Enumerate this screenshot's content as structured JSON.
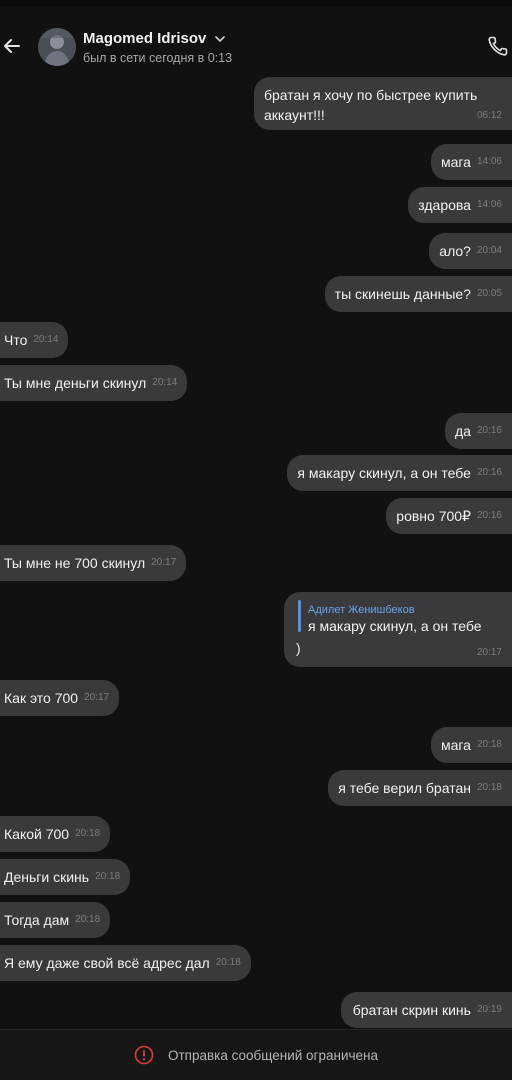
{
  "header": {
    "contact_name": "Magomed Idrisov",
    "last_seen": "был в сети сегодня в 0:13"
  },
  "icons": {
    "back": "arrow-left-icon",
    "chevron": "chevron-down-icon",
    "call": "phone-icon",
    "alert": "alert-circle-icon"
  },
  "messages": [
    {
      "dir": "out",
      "text_line1": "братан я хочу по быстрее купить",
      "text_line2": "аккаунт!!!",
      "time": "06:12"
    },
    {
      "dir": "out",
      "text": "мага",
      "time": "14:06"
    },
    {
      "dir": "out",
      "text": "здарова",
      "time": "14:06"
    },
    {
      "dir": "out",
      "text": "ало?",
      "time": "20:04"
    },
    {
      "dir": "out",
      "text": "ты скинешь данные?",
      "time": "20:05"
    },
    {
      "dir": "in",
      "text": "Что",
      "time": "20:14"
    },
    {
      "dir": "in",
      "text": "Ты мне деньги скинул",
      "time": "20:14"
    },
    {
      "dir": "out",
      "text": "да",
      "time": "20:16"
    },
    {
      "dir": "out",
      "text": "я макару скинул, а он тебе",
      "time": "20:16"
    },
    {
      "dir": "out",
      "text": "ровно 700₽",
      "time": "20:16"
    },
    {
      "dir": "in",
      "text": "Ты мне не 700 скинул",
      "time": "20:17"
    },
    {
      "dir": "out",
      "reply_author": "Адилет Женишбеков",
      "reply_text": "я макару скинул, а он тебе",
      "text": ")",
      "time": "20:17"
    },
    {
      "dir": "in",
      "text": "Как это 700",
      "time": "20:17"
    },
    {
      "dir": "out",
      "text": "мага",
      "time": "20:18"
    },
    {
      "dir": "out",
      "text": "я тебе верил братан",
      "time": "20:18"
    },
    {
      "dir": "in",
      "text": "Какой 700",
      "time": "20:18"
    },
    {
      "dir": "in",
      "text": "Деньги скинь",
      "time": "20:18"
    },
    {
      "dir": "in",
      "text": "Тогда дам",
      "time": "20:18"
    },
    {
      "dir": "in",
      "text": "Я ему даже свой всё адрес дал",
      "time": "20:18"
    },
    {
      "dir": "out",
      "text": "братан скрин кинь",
      "time": "20:19"
    }
  ],
  "footer": {
    "restricted_text": "Отправка сообщений ограничена"
  }
}
